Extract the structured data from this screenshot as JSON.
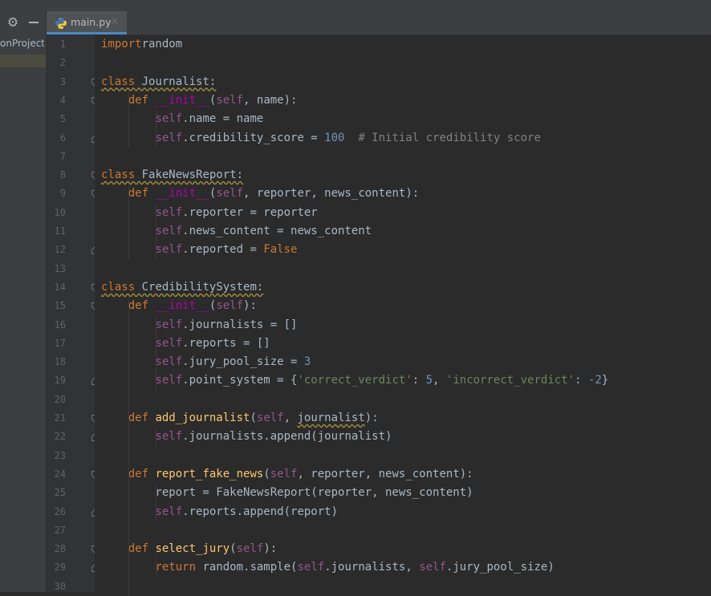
{
  "sidebar": {
    "project_label": "onProject"
  },
  "tabs": [
    {
      "label": "main.py",
      "close": "×"
    }
  ],
  "line_numbers": [
    "1",
    "2",
    "3",
    "4",
    "5",
    "6",
    "7",
    "8",
    "9",
    "10",
    "11",
    "12",
    "13",
    "14",
    "15",
    "16",
    "17",
    "18",
    "19",
    "20",
    "21",
    "22",
    "23",
    "24",
    "25",
    "26",
    "27",
    "28",
    "29",
    "30"
  ],
  "code": [
    [
      [
        "kw",
        "import"
      ],
      [
        "",
        "random"
      ]
    ],
    [],
    [
      [
        "kw squig",
        "class"
      ],
      [
        "squig",
        " Journalist:"
      ]
    ],
    [
      [
        "",
        "    "
      ],
      [
        "kw",
        "def "
      ],
      [
        "dunder",
        "__init__"
      ],
      [
        "",
        "("
      ],
      [
        "self",
        "self"
      ],
      [
        "",
        ", name):"
      ]
    ],
    [
      [
        "",
        "        "
      ],
      [
        "self",
        "self"
      ],
      [
        "",
        ".name = name"
      ]
    ],
    [
      [
        "",
        "        "
      ],
      [
        "self",
        "self"
      ],
      [
        "",
        ".credibility_score = "
      ],
      [
        "num",
        "100"
      ],
      [
        "",
        "  "
      ],
      [
        "cmt",
        "# Initial credibility score"
      ]
    ],
    [],
    [
      [
        "kw squig",
        "class"
      ],
      [
        "squig",
        " FakeNewsReport:"
      ]
    ],
    [
      [
        "",
        "    "
      ],
      [
        "kw",
        "def "
      ],
      [
        "dunder",
        "__init__"
      ],
      [
        "",
        "("
      ],
      [
        "self",
        "self"
      ],
      [
        "",
        ", reporter, news_content):"
      ]
    ],
    [
      [
        "",
        "        "
      ],
      [
        "self",
        "self"
      ],
      [
        "",
        ".reporter = reporter"
      ]
    ],
    [
      [
        "",
        "        "
      ],
      [
        "self",
        "self"
      ],
      [
        "",
        ".news_content = news_content"
      ]
    ],
    [
      [
        "",
        "        "
      ],
      [
        "self",
        "self"
      ],
      [
        "",
        ".reported = "
      ],
      [
        "kw",
        "False"
      ]
    ],
    [],
    [
      [
        "kw squig",
        "class"
      ],
      [
        "squig",
        " CredibilitySystem:"
      ]
    ],
    [
      [
        "",
        "    "
      ],
      [
        "kw",
        "def "
      ],
      [
        "dunder",
        "__init__"
      ],
      [
        "",
        "("
      ],
      [
        "self",
        "self"
      ],
      [
        "",
        "):"
      ]
    ],
    [
      [
        "",
        "        "
      ],
      [
        "self",
        "self"
      ],
      [
        "",
        ".journalists = []"
      ]
    ],
    [
      [
        "",
        "        "
      ],
      [
        "self",
        "self"
      ],
      [
        "",
        ".reports = []"
      ]
    ],
    [
      [
        "",
        "        "
      ],
      [
        "self",
        "self"
      ],
      [
        "",
        ".jury_pool_size = "
      ],
      [
        "num",
        "3"
      ]
    ],
    [
      [
        "",
        "        "
      ],
      [
        "self",
        "self"
      ],
      [
        "",
        ".point_system = {"
      ],
      [
        "str",
        "'correct_verdict'"
      ],
      [
        "",
        ": "
      ],
      [
        "num",
        "5"
      ],
      [
        "",
        ", "
      ],
      [
        "str",
        "'incorrect_verdict'"
      ],
      [
        "",
        ": "
      ],
      [
        "num",
        "-2"
      ],
      [
        "",
        "}"
      ]
    ],
    [],
    [
      [
        "",
        "    "
      ],
      [
        "kw",
        "def "
      ],
      [
        "fn",
        "add_journalist"
      ],
      [
        "",
        "("
      ],
      [
        "self",
        "self"
      ],
      [
        "",
        ", "
      ],
      [
        "squig",
        "journalist"
      ],
      [
        "",
        "):"
      ]
    ],
    [
      [
        "",
        "        "
      ],
      [
        "self",
        "self"
      ],
      [
        "",
        ".journalists.append(journalist)"
      ]
    ],
    [],
    [
      [
        "",
        "    "
      ],
      [
        "kw",
        "def "
      ],
      [
        "fn",
        "report_fake_news"
      ],
      [
        "",
        "("
      ],
      [
        "self",
        "self"
      ],
      [
        "",
        ", reporter, news_content):"
      ]
    ],
    [
      [
        "",
        "        report = FakeNewsReport(reporter, news_content)"
      ]
    ],
    [
      [
        "",
        "        "
      ],
      [
        "self",
        "self"
      ],
      [
        "",
        ".reports.append(report)"
      ]
    ],
    [],
    [
      [
        "",
        "    "
      ],
      [
        "kw",
        "def "
      ],
      [
        "fn",
        "select_jury"
      ],
      [
        "",
        "("
      ],
      [
        "self",
        "self"
      ],
      [
        "",
        "):"
      ]
    ],
    [
      [
        "",
        "        "
      ],
      [
        "kw",
        "return "
      ],
      [
        "",
        "random.sample("
      ],
      [
        "self",
        "self"
      ],
      [
        "",
        ".journalists, "
      ],
      [
        "self",
        "self"
      ],
      [
        "",
        ".jury_pool_size)"
      ]
    ],
    []
  ],
  "colors": {
    "accent": "#4a88c7",
    "keyword": "#cc7832",
    "self": "#94558d",
    "number": "#6897bb",
    "string": "#6a8759",
    "comment": "#808080",
    "function": "#ffc66d"
  },
  "icons": {
    "settings": "gear-icon",
    "collapse": "minus-icon",
    "file": "python-file-icon"
  }
}
